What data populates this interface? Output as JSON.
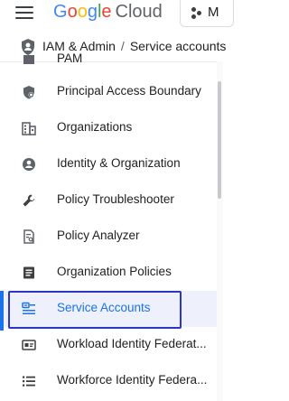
{
  "header": {
    "logo_google": "Google",
    "logo_cloud": "Cloud",
    "project_button_label": "M"
  },
  "breadcrumb": {
    "section": "IAM & Admin",
    "separator": "/",
    "page": "Service accounts"
  },
  "nav": {
    "items": [
      {
        "label": "PAM",
        "icon": "pam-icon"
      },
      {
        "label": "Principal Access Boundary",
        "icon": "boundary-shield-icon"
      },
      {
        "label": "Organizations",
        "icon": "organization-building-icon"
      },
      {
        "label": "Identity & Organization",
        "icon": "account-circle-icon"
      },
      {
        "label": "Policy Troubleshooter",
        "icon": "wrench-icon"
      },
      {
        "label": "Policy Analyzer",
        "icon": "document-search-icon"
      },
      {
        "label": "Organization Policies",
        "icon": "policy-list-icon"
      },
      {
        "label": "Service Accounts",
        "icon": "service-account-icon",
        "active": true
      },
      {
        "label": "Workload Identity Federat...",
        "icon": "id-card-icon"
      },
      {
        "label": "Workforce Identity Federa...",
        "icon": "list-icon"
      }
    ]
  },
  "colors": {
    "accent": "#1a73e8",
    "active_bg": "#eef1fb",
    "focus_outline": "#2b36c9"
  }
}
